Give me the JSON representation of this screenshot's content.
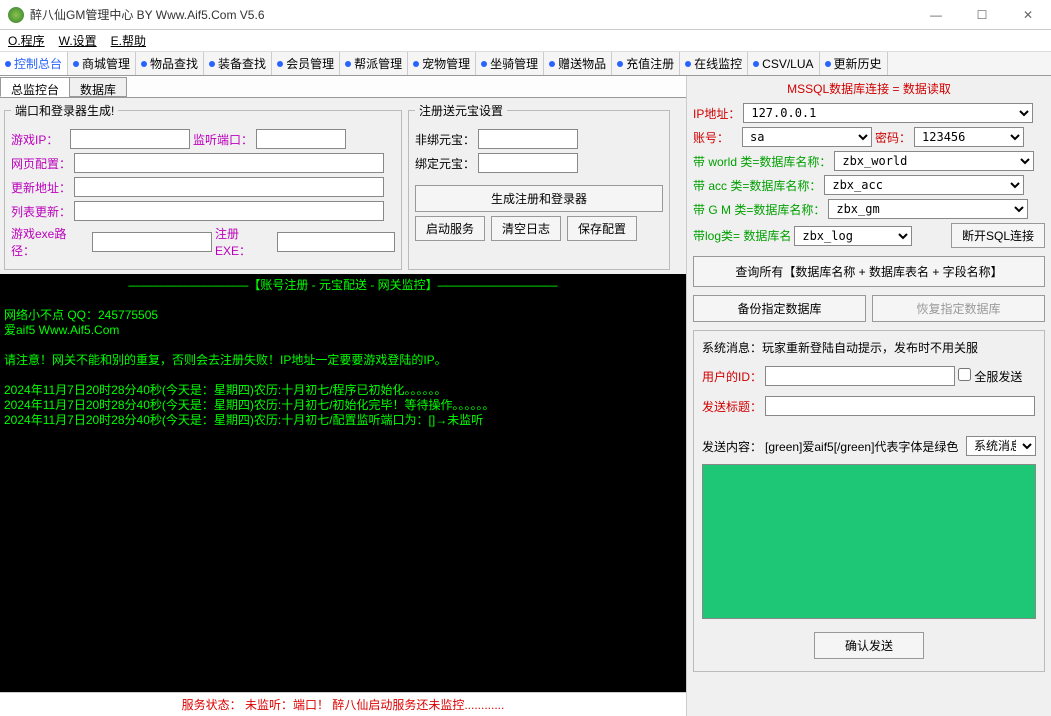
{
  "window": {
    "title": "醉八仙GM管理中心 BY Www.Aif5.Com  V5.6",
    "min": "—",
    "max": "☐",
    "close": "✕"
  },
  "menubar": {
    "items": [
      "O.程序",
      "W.设置",
      "E.帮助"
    ]
  },
  "tabs": {
    "items": [
      "控制总台",
      "商城管理",
      "物品查找",
      "装备查找",
      "会员管理",
      "帮派管理",
      "宠物管理",
      "坐骑管理",
      "赠送物品",
      "充值注册",
      "在线监控",
      "CSV/LUA",
      "更新历史"
    ]
  },
  "subtabs": {
    "items": [
      "总监控台",
      "数据库"
    ]
  },
  "group_port": {
    "legend": "端口和登录器生成!",
    "game_ip_label": "游戏IP：",
    "listen_port_label": "监听端口：",
    "web_cfg_label": "网页配置：",
    "update_addr_label": "更新地址：",
    "list_update_label": "列表更新：",
    "exe_path_label": "游戏exe路径：",
    "reg_exe_label": "注册EXE："
  },
  "group_reg": {
    "legend": "注册送元宝设置",
    "unbound_label": "非绑元宝：",
    "bound_label": "绑定元宝：",
    "btn_gen": "生成注册和登录器",
    "btn_start": "启动服务",
    "btn_clear": "清空日志",
    "btn_save": "保存配置"
  },
  "console": {
    "header": "【账号注册 - 元宝配送 - 网关监控】——————————",
    "line1": "网络小不点 QQ：245775505",
    "line2": "爱aif5 Www.Aif5.Com",
    "warn": "请注意！网关不能和别的重复，否则会去注册失败！IP地址一定要要游戏登陆的IP。",
    "log1": "2024年11月7日20时28分40秒(今天是：星期四)农历:十月初七/程序已初始化。。。。。。",
    "log2": "2024年11月7日20时28分40秒(今天是：星期四)农历:十月初七/初始化完毕！等待操作。。。。。。",
    "log3": "2024年11月7日20时28分40秒(今天是：星期四)农历:十月初七/配置监听端口为：[]→未监听"
  },
  "status": "服务状态：   未监听：端口！   醉八仙启动服务还未监控............",
  "db": {
    "header": "MSSQL数据库连接 = 数据读取",
    "ip_label": "IP地址：",
    "ip_val": "127.0.0.1",
    "acc_label": "账号：",
    "acc_val": "sa",
    "pwd_label": "密码：",
    "pwd_val": "123456",
    "world_label": "带 world 类=数据库名称：",
    "world_val": "zbx_world",
    "accdb_label": "带  acc  类=数据库名称：",
    "accdb_val": "zbx_acc",
    "gm_label": "带  G M  类=数据库名称：",
    "gm_val": "zbx_gm",
    "log_label": "带log类= 数据库名",
    "log_val": "zbx_log",
    "btn_disconnect": "断开SQL连接",
    "btn_query": "查询所有【数据库名称 + 数据库表名 + 字段名称】",
    "btn_backup": "备份指定数据库",
    "btn_restore": "恢复指定数据库"
  },
  "msg": {
    "sys_note": "系统消息：玩家重新登陆自动提示，发布时不用关服",
    "user_id_label": "用户的ID：",
    "cb_all": "全服发送",
    "title_label": "发送标题：",
    "content_label": "发送内容：",
    "content_hint": "[green]爱aif5[/green]代表字体是绿色",
    "dropdown": "系统消息",
    "btn_send": "确认发送"
  }
}
